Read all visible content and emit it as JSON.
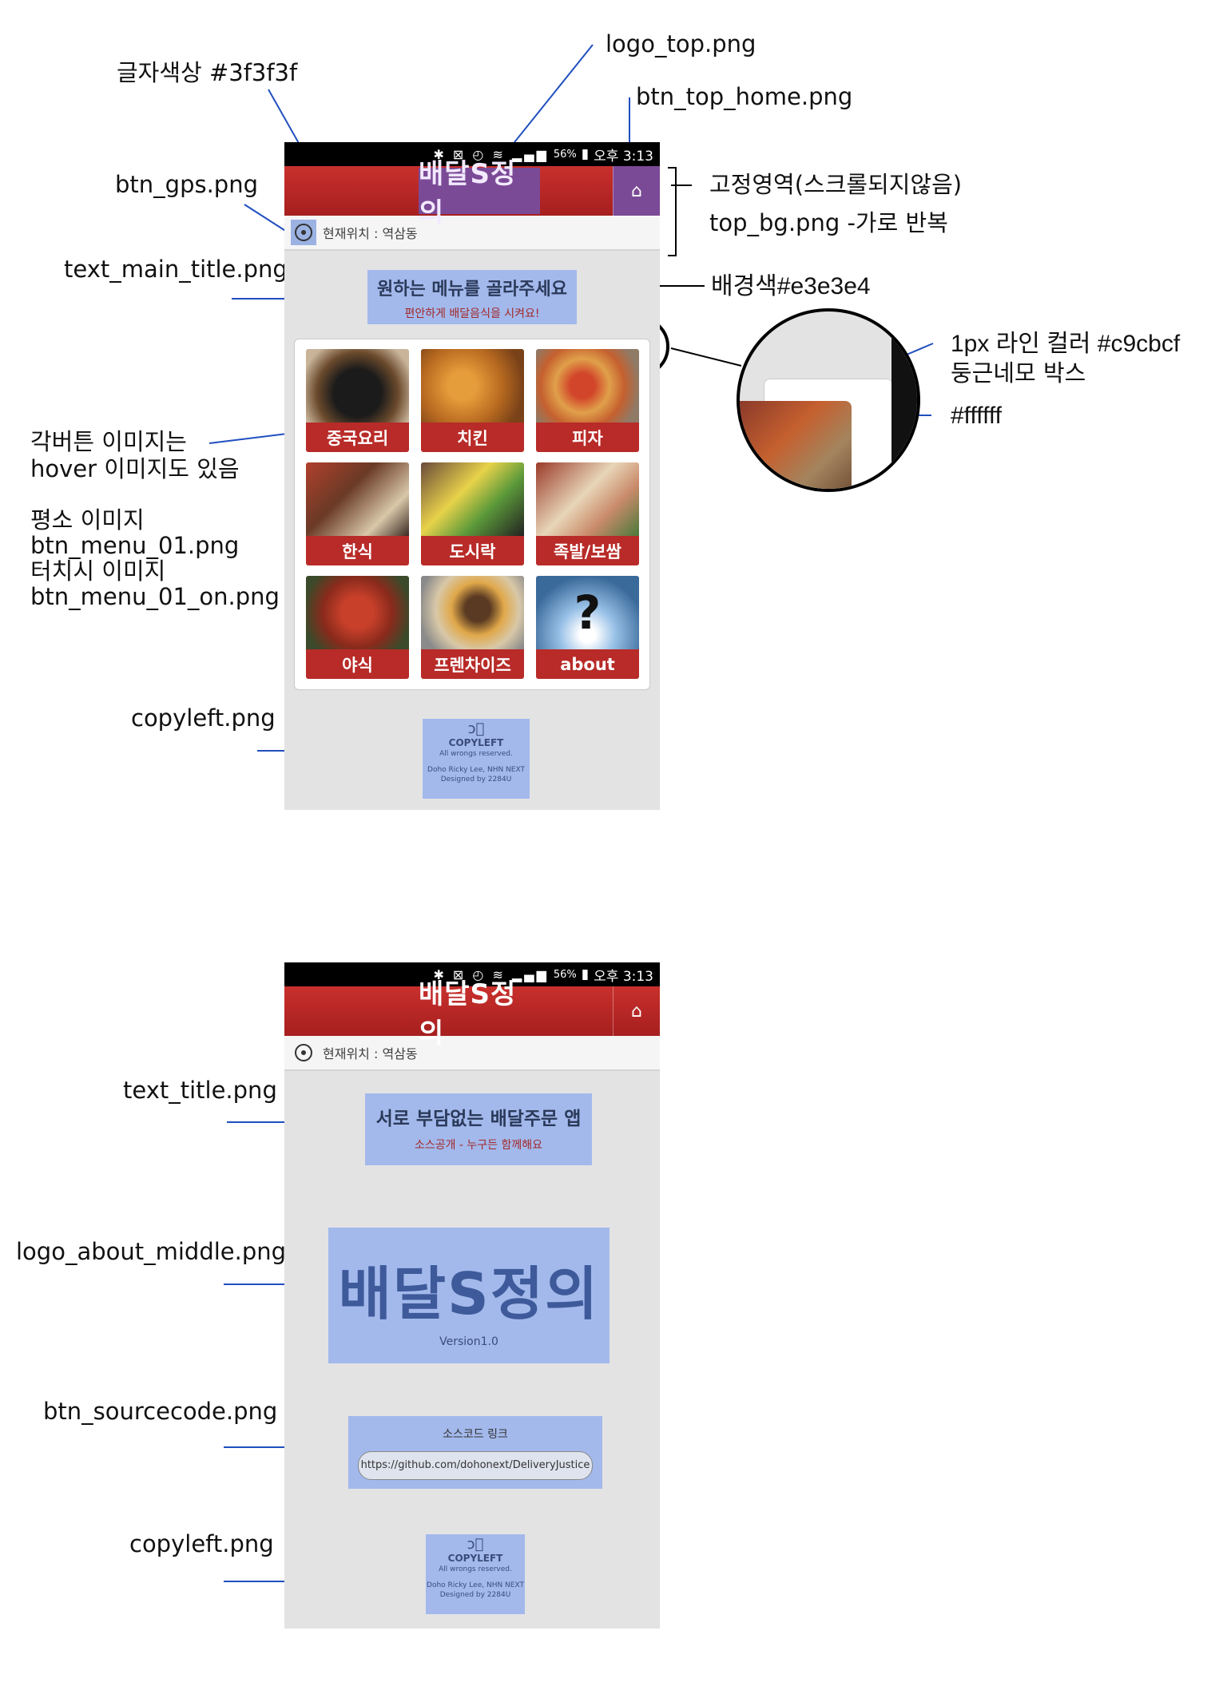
{
  "annotations": {
    "text_color": "글자색상 #3f3f3f",
    "logo_top": "logo_top.png",
    "btn_top_home": "btn_top_home.png",
    "btn_gps": "btn_gps.png",
    "fixed_area": "고정영역(스크롤되지않음)",
    "top_bg": "top_bg.png -가로 반복",
    "text_main_title": "text_main_title.png",
    "bg_color": "배경색#e3e3e4",
    "line_color": "1px 라인 컬러 #c9cbcf",
    "rounded_box": "둥근네모 박스",
    "white": "#ffffff",
    "hover_1": "각버튼 이미지는",
    "hover_2": "hover 이미지도 있음",
    "normal_img": "평소 이미지",
    "normal_file": "btn_menu_01.png",
    "touch_img": "터치시 이미지",
    "touch_file": "btn_menu_01_on.png",
    "copyleft_1": "copyleft.png",
    "text_title": "text_title.png",
    "logo_about_middle": "logo_about_middle.png",
    "btn_sourcecode": "btn_sourcecode.png",
    "copyleft_2": "copyleft.png"
  },
  "statusbar": {
    "battery": "56%",
    "time": "오후 3:13"
  },
  "header": {
    "logo": "배달S정의",
    "home_icon": "home-icon",
    "location": "현재위치 : 역삼동"
  },
  "main_screen": {
    "title": "원하는 메뉴를 골라주세요",
    "subtitle": "편안하게 배달음식을 시켜요!",
    "menu": [
      {
        "label": "중국요리"
      },
      {
        "label": "치킨"
      },
      {
        "label": "피자"
      },
      {
        "label": "한식"
      },
      {
        "label": "도시락"
      },
      {
        "label": "족발/보쌈"
      },
      {
        "label": "야식"
      },
      {
        "label": "프렌차이즈"
      },
      {
        "label": "about"
      }
    ]
  },
  "copyleft": {
    "title": "COPYLEFT",
    "line1": "All wrongs reserved.",
    "line2": "Doho Ricky Lee, NHN NEXT",
    "line3": "Designed by 2284U"
  },
  "about_screen": {
    "title": "서로 부담없는 배달주문 앱",
    "subtitle": "소스공개 - 누구든 함께해요",
    "logo": "배달S정의",
    "version": "Version1.0",
    "source_label": "소스코드 링크",
    "source_url": "https://github.com/dohonext/DeliveryJustice"
  }
}
